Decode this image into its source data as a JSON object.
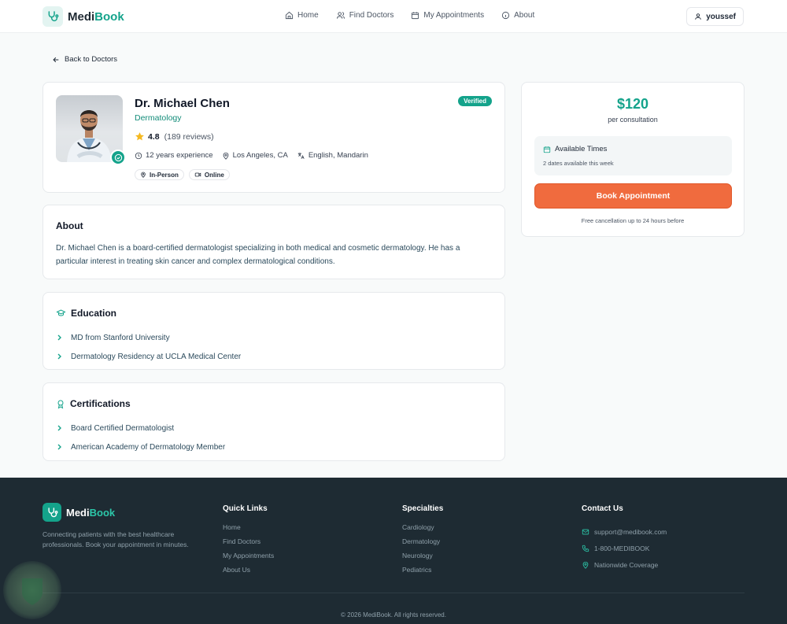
{
  "brand": {
    "name_part1": "Medi",
    "name_part2": "Book"
  },
  "nav": {
    "items": [
      {
        "label": "Home",
        "icon": "home-icon"
      },
      {
        "label": "Find Doctors",
        "icon": "users-icon"
      },
      {
        "label": "My Appointments",
        "icon": "calendar-icon"
      },
      {
        "label": "About",
        "icon": "info-icon"
      }
    ],
    "user": "youssef"
  },
  "back_label": "Back to Doctors",
  "doctor": {
    "name": "Dr. Michael Chen",
    "specialty": "Dermatology",
    "rating": "4.8",
    "reviews": "(189 reviews)",
    "experience": "12 years experience",
    "location": "Los Angeles, CA",
    "languages": "English, Mandarin",
    "modes": [
      "In-Person",
      "Online"
    ],
    "badge": "Verified"
  },
  "about": {
    "title": "About",
    "text": "Dr. Michael Chen is a board-certified dermatologist specializing in both medical and cosmetic dermatology. He has a particular interest in treating skin cancer and complex dermatological conditions."
  },
  "education": {
    "title": "Education",
    "items": [
      "MD from Stanford University",
      "Dermatology Residency at UCLA Medical Center"
    ]
  },
  "certifications": {
    "title": "Certifications",
    "items": [
      "Board Certified Dermatologist",
      "American Academy of Dermatology Member"
    ]
  },
  "booking": {
    "price": "$120",
    "per": "per consultation",
    "available_title": "Available Times",
    "available_sub": "2 dates available this week",
    "button": "Book Appointment",
    "cancel_note": "Free cancellation up to 24 hours before"
  },
  "footer": {
    "tagline": "Connecting patients with the best healthcare professionals. Book your appointment in minutes.",
    "quick_links": {
      "title": "Quick Links",
      "items": [
        "Home",
        "Find Doctors",
        "My Appointments",
        "About Us"
      ]
    },
    "specialties": {
      "title": "Specialties",
      "items": [
        "Cardiology",
        "Dermatology",
        "Neurology",
        "Pediatrics"
      ]
    },
    "contact": {
      "title": "Contact Us",
      "email": "support@medibook.com",
      "phone": "1-800-MEDIBOOK",
      "coverage": "Nationwide Coverage"
    },
    "copyright": "© 2026 MediBook. All rights reserved."
  },
  "colors": {
    "primary": "#14a38b",
    "accent": "#f06b3e",
    "footer_bg": "#1e2b33"
  }
}
